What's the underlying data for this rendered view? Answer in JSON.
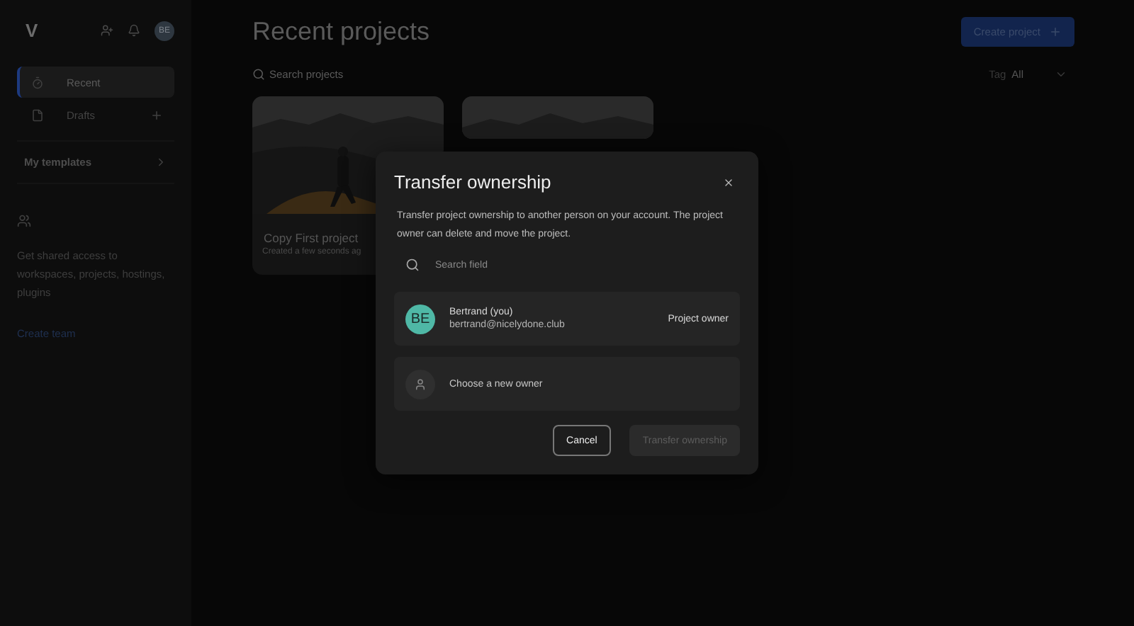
{
  "header": {
    "logo": "V",
    "avatar": "BE"
  },
  "sidebar": {
    "items": [
      {
        "label": "Recent",
        "selected": true,
        "kind": "recent"
      },
      {
        "label": "Drafts",
        "selected": false,
        "kind": "drafts"
      }
    ],
    "templates": "My templates",
    "team": {
      "text": "Get shared access to workspaces, projects, hostings, plugins",
      "link": "Create team"
    }
  },
  "main": {
    "title": "Recent projects",
    "create_button": "Create project",
    "search": {
      "placeholder": "Search projects"
    },
    "tag": {
      "label": "Tag",
      "value": "All"
    },
    "projects": [
      {
        "kind": "picture",
        "name": "Copy First project",
        "meta": "Created a few seconds ag"
      },
      {
        "kind": "picture"
      }
    ]
  },
  "dialog": {
    "title": "Transfer ownership",
    "description": "Transfer project ownership to another person on your account. The project owner can delete and move the project.",
    "search": {
      "placeholder": "Search field"
    },
    "owner": {
      "initials": "BE",
      "name": "Bertrand (you)",
      "email": "bertrand@nicelydone.club",
      "role": "Project owner",
      "color": "#4fb8a6"
    },
    "new_owner": "Choose a new owner",
    "buttons": [
      {
        "label": "Cancel",
        "kind": "secondary",
        "disabled": false
      },
      {
        "label": "Transfer ownership",
        "kind": "primary",
        "disabled": true
      }
    ]
  }
}
